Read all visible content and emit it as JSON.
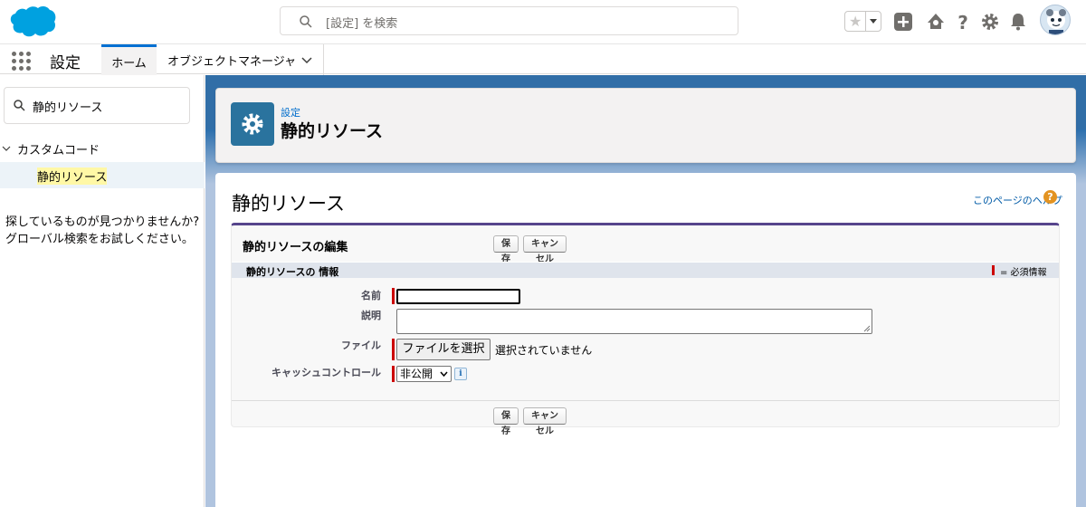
{
  "header": {
    "search_placeholder": "[設定] を検索"
  },
  "context_bar": {
    "app_name": "設定",
    "tabs": [
      {
        "label": "ホーム"
      },
      {
        "label": "オブジェクトマネージャ"
      }
    ]
  },
  "sidebar": {
    "search_value": "静的リソース",
    "tree": {
      "node_label": "カスタムコード",
      "leaf_label": "静的リソース"
    },
    "help_text": "探しているものが見つかりませんか? グローバル検索をお試しください。"
  },
  "page_header": {
    "eyebrow": "設定",
    "title": "静的リソース"
  },
  "content": {
    "title": "静的リソース",
    "help_link": "このページのヘルプ",
    "help_icon": "?",
    "block_title": "静的リソースの編集",
    "save_label": "保存",
    "cancel_label": "キャンセル",
    "section_title": "静的リソースの 情報",
    "required_legend": "= 必須情報",
    "fields": {
      "name_label": "名前",
      "description_label": "説明",
      "file_label": "ファイル",
      "file_button": "ファイルを選択",
      "file_status": "選択されていません",
      "cache_label": "キャッシュコントロール",
      "cache_value": "非公開",
      "info_icon": "i"
    }
  },
  "colors": {
    "brand_blue": "#00a1e0",
    "link_blue": "#006dcc",
    "setup_icon_bg": "#2a739e",
    "required_red": "#c00",
    "block_accent": "#56458c"
  }
}
